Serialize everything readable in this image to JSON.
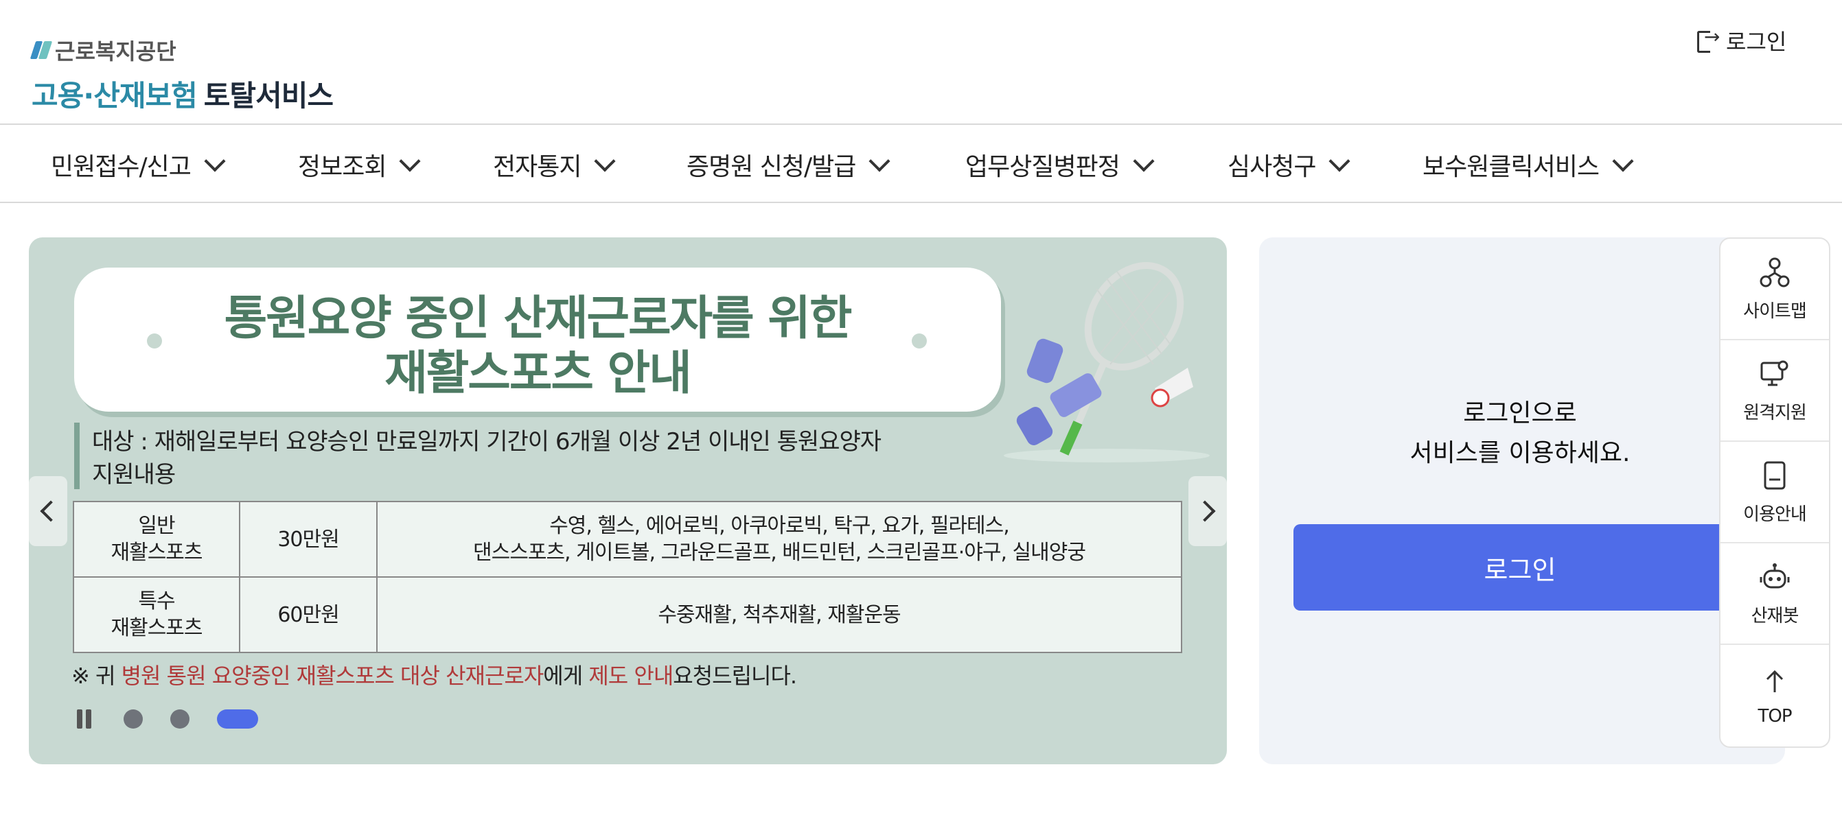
{
  "header": {
    "logo_org": "근로복지공단",
    "logo_service_a": "고용·산재보험",
    "logo_service_b": "토탈서비스",
    "login_label": "로그인"
  },
  "gnb": {
    "items": [
      {
        "label": "민원접수/신고"
      },
      {
        "label": "정보조회"
      },
      {
        "label": "전자통지"
      },
      {
        "label": "증명원 신청/발급"
      },
      {
        "label": "업무상질병판정"
      },
      {
        "label": "심사청구"
      },
      {
        "label": "보수원클릭서비스"
      }
    ]
  },
  "banner": {
    "title_line1": "통원요양 중인 산재근로자를 위한",
    "title_line2": "재활스포츠 안내",
    "target": "대상 : 재해일로부터 요양승인 만료일까지 기간이 6개월 이상 2년 이내인 통원요양자",
    "support_heading": "지원내용",
    "table": [
      {
        "type_a": "일반",
        "type_b": "재활스포츠",
        "amount": "30만원",
        "detail_a": "수영, 헬스, 에어로빅, 아쿠아로빅, 탁구, 요가, 필라테스,",
        "detail_b": "댄스스포츠, 게이트볼, 그라운드골프, 배드민턴, 스크린골프·야구, 실내양궁"
      },
      {
        "type_a": "특수",
        "type_b": "재활스포츠",
        "amount": "60만원",
        "detail_a": "수중재활, 척추재활, 재활운동",
        "detail_b": ""
      }
    ],
    "note_prefix": "※ 귀 ",
    "note_red1": "병원 통원 요양중인 재활스포츠 대상 산재근로자",
    "note_mid": "에게 ",
    "note_red2": "제도 안내",
    "note_suffix": "요청드립니다.",
    "slides_total": 3,
    "active_slide": 3,
    "accent_color": "#4f6ce8"
  },
  "login_panel": {
    "message_line1": "로그인으로",
    "message_line2": "서비스를 이용하세요.",
    "button_label": "로그인"
  },
  "quick_menu": {
    "items": [
      {
        "label": "사이트맵",
        "icon": "sitemap-icon"
      },
      {
        "label": "원격지원",
        "icon": "remote-support-icon"
      },
      {
        "label": "이용안내",
        "icon": "guide-book-icon"
      },
      {
        "label": "산재봇",
        "icon": "chatbot-icon"
      },
      {
        "label": "TOP",
        "icon": "arrow-up-icon"
      }
    ]
  }
}
